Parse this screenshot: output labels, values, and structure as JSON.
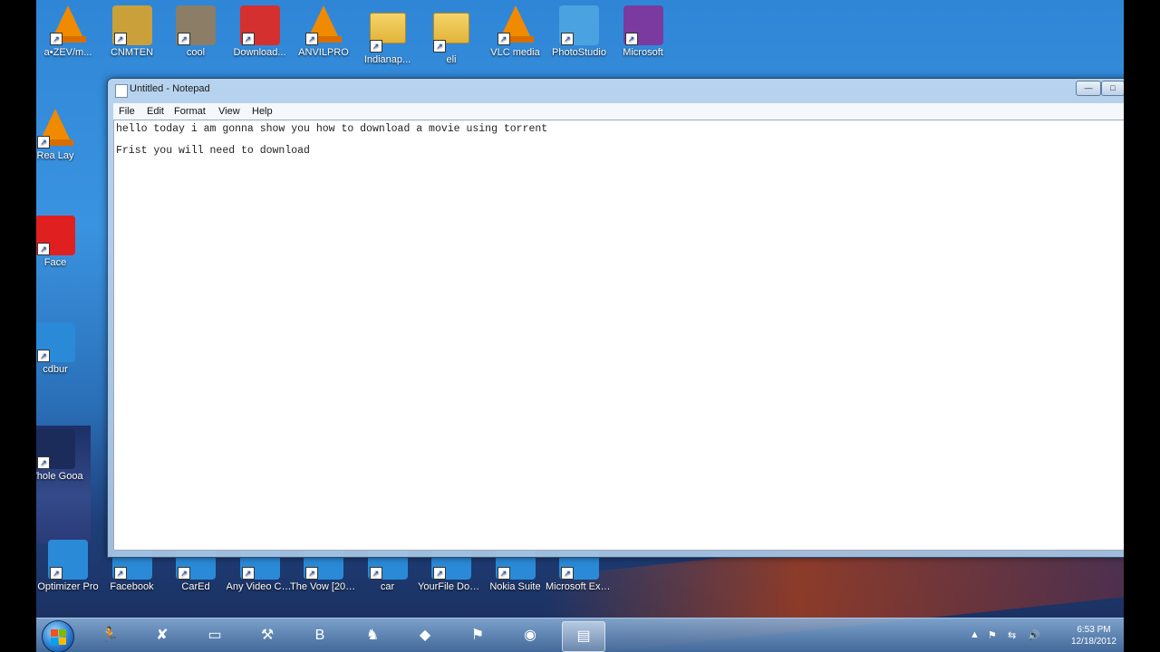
{
  "desktop": {
    "top_icons": [
      {
        "label": "a•ZEV/m...",
        "kind": "vlc"
      },
      {
        "label": "CNMTEN",
        "kind": "gold"
      },
      {
        "label": "cool",
        "kind": "photo"
      },
      {
        "label": "Download...",
        "kind": "puzzle"
      },
      {
        "label": "ANVILPRO",
        "kind": "vlc"
      },
      {
        "label": "Indianap...",
        "kind": "folder"
      },
      {
        "label": "eli",
        "kind": "folder"
      },
      {
        "label": "VLC media",
        "kind": "vlc"
      },
      {
        "label": "PhotoStudio",
        "kind": "photo2"
      },
      {
        "label": "Microsoft",
        "kind": "four"
      }
    ],
    "left_icons": [
      {
        "label": "Rea Lay",
        "kind": "vlc"
      },
      {
        "label": "Face",
        "kind": "red"
      },
      {
        "label": "cdbur",
        "kind": "blue"
      },
      {
        "label": "Whole Gooa",
        "kind": "dark"
      }
    ],
    "bottom_icons": [
      {
        "label": "Optimizer Pro"
      },
      {
        "label": "Facebook"
      },
      {
        "label": "CarEd"
      },
      {
        "label": "Any Video Converte..."
      },
      {
        "label": "The Vow [2012] ..."
      },
      {
        "label": "car"
      },
      {
        "label": "YourFile Downloader"
      },
      {
        "label": "Nokia Suite"
      },
      {
        "label": "Microsoft Expressi..."
      }
    ]
  },
  "notepad": {
    "title": "Untitled - Notepad",
    "controls": {
      "min": "—",
      "max": "□",
      "close": "✕"
    },
    "menu": [
      "File",
      "Edit",
      "Format",
      "View",
      "Help"
    ],
    "lines": [
      "hello today i am gonna show you how to download a movie using torrent",
      "Frist you will need to download"
    ]
  },
  "taskbar": {
    "items": [
      {
        "icon": "counter-strike-icon",
        "glyph": "🏃"
      },
      {
        "icon": "game-icon",
        "glyph": "✘"
      },
      {
        "icon": "monitor-icon",
        "glyph": "▭"
      },
      {
        "icon": "network-icon",
        "glyph": "⚒"
      },
      {
        "icon": "app-b-icon",
        "glyph": "B"
      },
      {
        "icon": "character-icon",
        "glyph": "♞"
      },
      {
        "icon": "sims-icon",
        "glyph": "◆"
      },
      {
        "icon": "racing-icon",
        "glyph": "⚑"
      },
      {
        "icon": "chrome-icon",
        "glyph": "◉"
      },
      {
        "icon": "notepad-icon",
        "glyph": "▤",
        "active": true
      }
    ],
    "clock_time": "6:53 PM",
    "clock_date": "12/18/2012",
    "colors": {
      "accent": "#3a93e0",
      "close": "#c5432c"
    }
  }
}
